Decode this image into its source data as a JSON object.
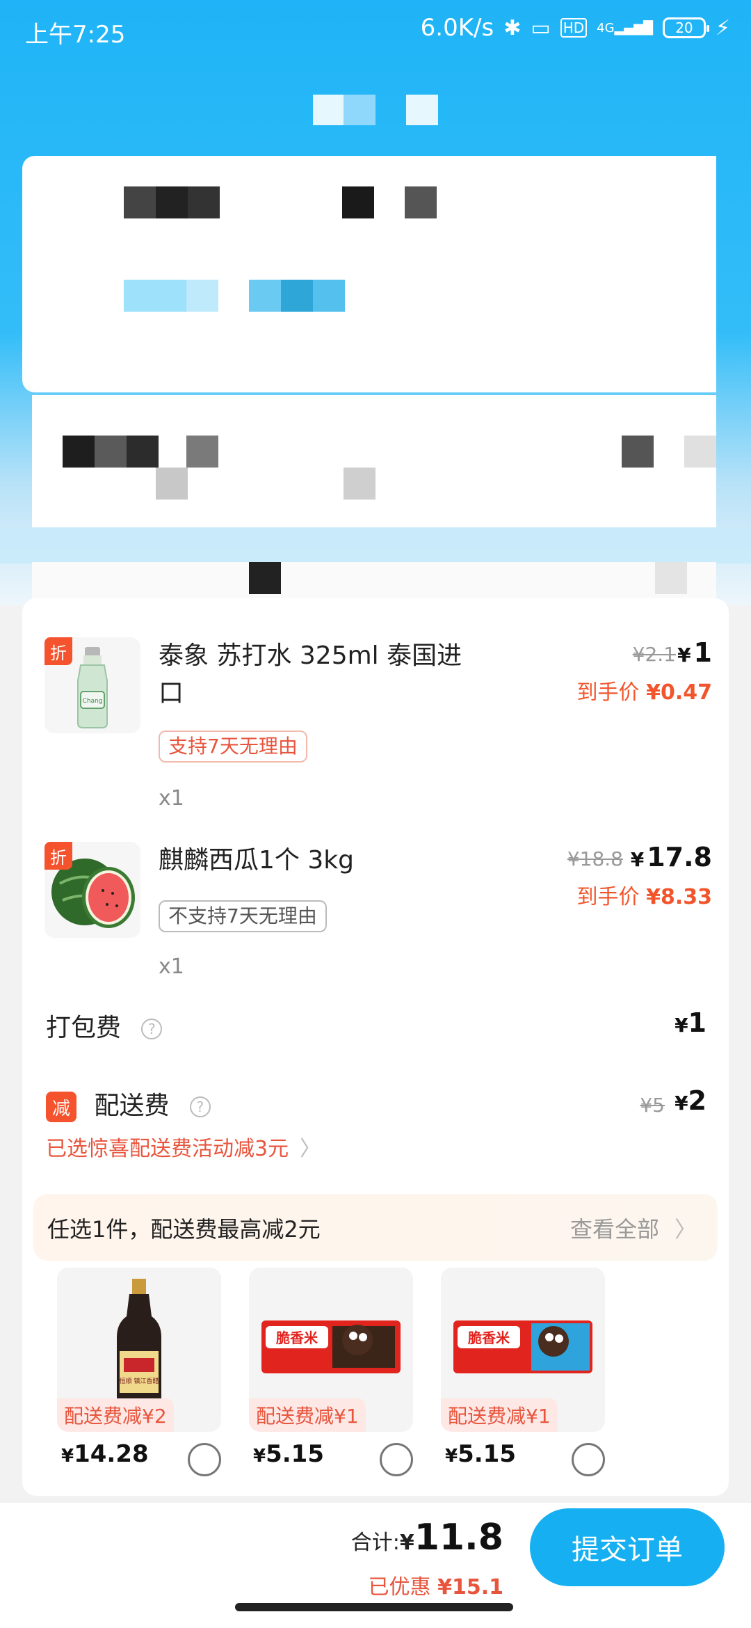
{
  "status_bar": {
    "time": "上午7:25",
    "net_speed": "6.0K/s",
    "hd": "HD",
    "signal": "4G",
    "battery": "20"
  },
  "items": [
    {
      "name": "泰象 苏打水 325ml 泰国进口",
      "orig_price": "¥2.1",
      "price_symbol": "¥",
      "price": "1",
      "final_label": "到手价",
      "final_price": "¥0.47",
      "tag": "折",
      "support": "支持7天无理由",
      "qty": "x1"
    },
    {
      "name": "麒麟西瓜1个 3kg",
      "orig_price": "¥18.8",
      "price_symbol": "¥",
      "price": "17.8",
      "final_label": "到手价",
      "final_price": "¥8.33",
      "tag": "折",
      "support": "不支持7天无理由",
      "qty": "x1"
    }
  ],
  "packing_fee": {
    "label": "打包费",
    "help": "?",
    "symbol": "¥",
    "amount": "1"
  },
  "delivery_fee": {
    "badge": "减",
    "label": "配送费",
    "help": "?",
    "orig": "¥5",
    "symbol": "¥",
    "amount": "2",
    "activity": "已选惊喜配送费活动减3元"
  },
  "promo": {
    "text": "任选1件，配送费最高减2元",
    "more": "查看全部"
  },
  "recommend": [
    {
      "tag": "配送费减¥2",
      "symbol": "¥",
      "price": "14.28",
      "label_text": "恒顺 镇江香醋"
    },
    {
      "tag": "配送费减¥1",
      "symbol": "¥",
      "price": "5.15",
      "label_text": "脆香米"
    },
    {
      "tag": "配送费减¥1",
      "symbol": "¥",
      "price": "5.15",
      "label_text": "脆香米"
    }
  ],
  "bottom": {
    "total_label": "合计:",
    "symbol": "¥",
    "total": "11.8",
    "saved_label": "已优惠",
    "saved": "¥15.1",
    "submit": "提交订单"
  },
  "colors": {
    "accent_blue": "#16b0f2",
    "discount_red": "#f5522e"
  }
}
